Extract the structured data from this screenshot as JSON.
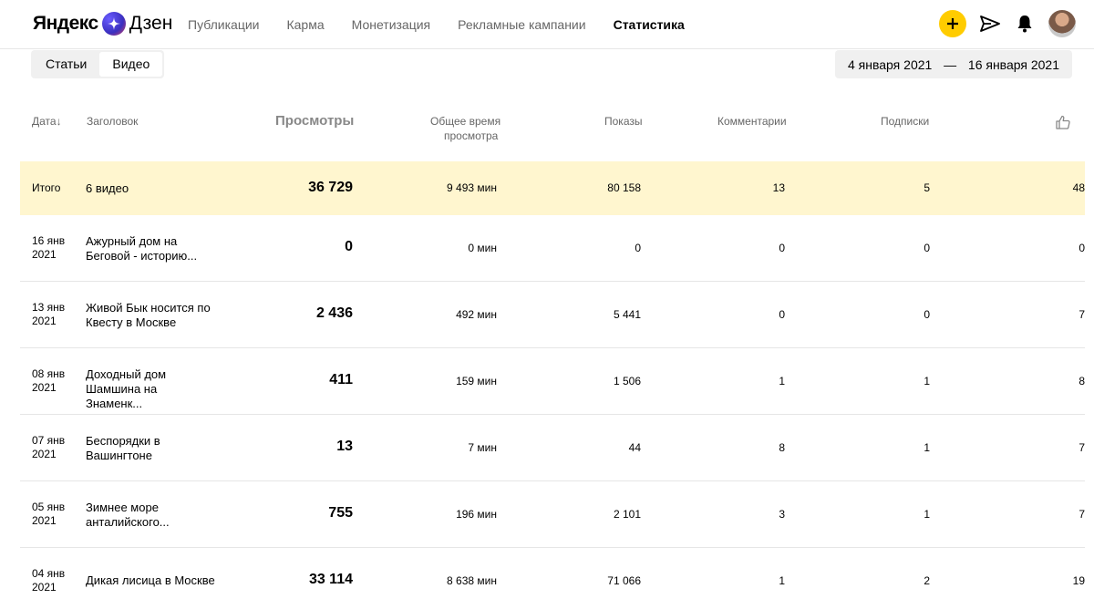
{
  "header": {
    "logo_left": "Яндекс",
    "logo_right": "Дзен",
    "nav": [
      {
        "label": "Публикации",
        "active": false
      },
      {
        "label": "Карма",
        "active": false
      },
      {
        "label": "Монетизация",
        "active": false
      },
      {
        "label": "Рекламные кампании",
        "active": false
      },
      {
        "label": "Статистика",
        "active": true
      }
    ]
  },
  "toggle": {
    "articles": "Статьи",
    "video": "Видео"
  },
  "daterange": {
    "from": "4 января 2021",
    "sep": "—",
    "to": "16 января 2021"
  },
  "table": {
    "headers": {
      "date": "Дата↓",
      "title": "Заголовок",
      "views": "Просмотры",
      "time_1": "Общее время",
      "time_2": "просмотра",
      "shows": "Показы",
      "comments": "Комментарии",
      "subs": "Подписки"
    },
    "total": {
      "label": "Итого",
      "title": "6 видео",
      "views": "36 729",
      "time": "9 493 мин",
      "shows": "80 158",
      "comments": "13",
      "subs": "5",
      "likes": "48"
    },
    "rows": [
      {
        "date1": "16 янв",
        "date2": "2021",
        "title1": "Ажурный дом на",
        "title2": "Беговой - историю...",
        "views": "0",
        "time": "0 мин",
        "shows": "0",
        "comments": "0",
        "subs": "0",
        "likes": "0"
      },
      {
        "date1": "13 янв",
        "date2": "2021",
        "title1": "Живой Бык носится по",
        "title2": "Квесту в Москве",
        "views": "2 436",
        "time": "492 мин",
        "shows": "5 441",
        "comments": "0",
        "subs": "0",
        "likes": "7"
      },
      {
        "date1": "08 янв",
        "date2": "2021",
        "title1": "Доходный дом",
        "title2": "Шамшина на Знаменк...",
        "views": "411",
        "time": "159 мин",
        "shows": "1 506",
        "comments": "1",
        "subs": "1",
        "likes": "8"
      },
      {
        "date1": "07 янв",
        "date2": "2021",
        "title1": "Беспорядки в",
        "title2": "Вашингтоне",
        "views": "13",
        "time": "7 мин",
        "shows": "44",
        "comments": "8",
        "subs": "1",
        "likes": "7"
      },
      {
        "date1": "05 янв",
        "date2": "2021",
        "title1": "Зимнее море",
        "title2": "анталийского...",
        "views": "755",
        "time": "196 мин",
        "shows": "2 101",
        "comments": "3",
        "subs": "1",
        "likes": "7"
      },
      {
        "date1": "04 янв",
        "date2": "2021",
        "title1": "Дикая лисица в Москве",
        "title2": "",
        "views": "33 114",
        "time": "8 638 мин",
        "shows": "71 066",
        "comments": "1",
        "subs": "2",
        "likes": "19"
      }
    ]
  },
  "colors": {
    "accent": "#ffcc00",
    "total_bg": "#fff6cf"
  }
}
